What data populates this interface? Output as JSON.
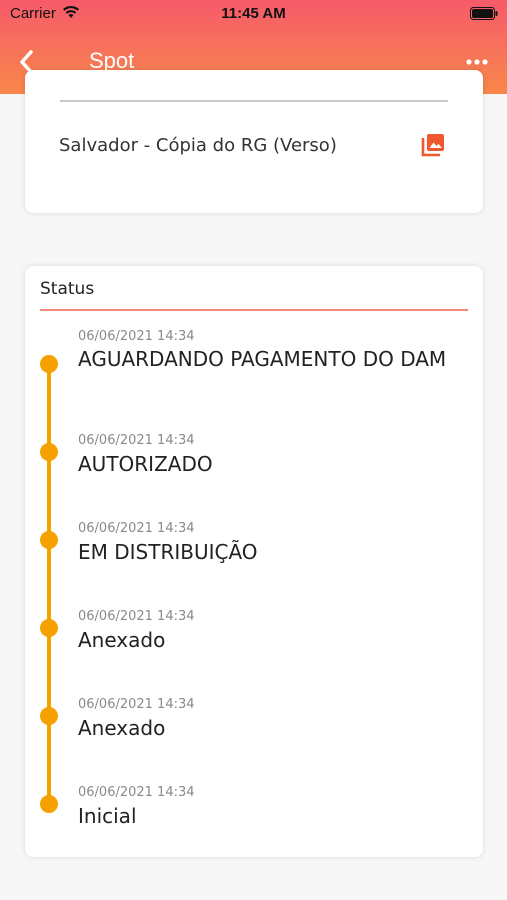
{
  "status_bar": {
    "carrier": "Carrier",
    "time": "11:45 AM"
  },
  "nav": {
    "title": "Spot",
    "back_icon": "chevron-left-icon",
    "more_icon": "ellipsis-icon"
  },
  "document": {
    "label": "Salvador - Cópia do RG (Verso)",
    "icon": "photo-library-icon"
  },
  "status": {
    "title": "Status",
    "events": [
      {
        "timestamp": "06/06/2021 14:34",
        "label": " AGUARDANDO PAGAMENTO DO DAM"
      },
      {
        "timestamp": "06/06/2021 14:34",
        "label": " AUTORIZADO"
      },
      {
        "timestamp": "06/06/2021 14:34",
        "label": " EM DISTRIBUIÇÃO"
      },
      {
        "timestamp": "06/06/2021 14:34",
        "label": " Anexado"
      },
      {
        "timestamp": "06/06/2021 14:34",
        "label": " Anexado"
      },
      {
        "timestamp": "06/06/2021 14:34",
        "label": " Inicial"
      }
    ]
  },
  "colors": {
    "accent": "#f5a100",
    "header_top": "#f75a6a",
    "header_bottom": "#f8874a",
    "doc_icon": "#f0582e"
  }
}
